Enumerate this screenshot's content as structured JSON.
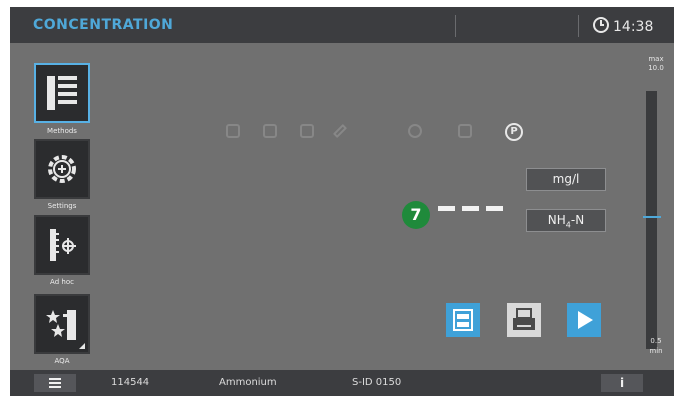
{
  "header": {
    "title": "CONCENTRATION",
    "time": "14:38",
    "clock_icon": "clock-icon"
  },
  "sidebar": {
    "items": [
      {
        "label": "Methods",
        "icon": "methods-list-icon",
        "active": true
      },
      {
        "label": "Settings",
        "icon": "gear-icon",
        "active": false
      },
      {
        "label": "Ad hoc",
        "icon": "ruler-measure-icon",
        "active": false
      },
      {
        "label": "AQA",
        "icon": "stars-icon",
        "active": false
      }
    ]
  },
  "toolbar": {
    "icons": [
      "memory-icon",
      "clipboard-icon",
      "database-icon",
      "edit-icon",
      "globe-icon",
      "calendar-icon"
    ],
    "active_icon": {
      "label": "P",
      "icon": "p-circle-icon"
    }
  },
  "result": {
    "step": "7",
    "value": "---",
    "unit": "mg/l",
    "form_main": "NH",
    "form_sub": "4",
    "form_tail": "-N"
  },
  "scale": {
    "max_label": "max",
    "max_value": "10.0",
    "min_value": "0.5",
    "min_label": "min",
    "marker_level": 0.5
  },
  "actions": {
    "icons": [
      "list-view-icon",
      "print-icon",
      "play-icon"
    ]
  },
  "footer": {
    "method_number": "114544",
    "method_name": "Ammonium",
    "id": "S-ID 0150",
    "info": "i"
  },
  "colors": {
    "accent": "#4fa8d8",
    "badge": "#1f8a3b",
    "background": "#707070",
    "bars": "#3c3d40"
  }
}
